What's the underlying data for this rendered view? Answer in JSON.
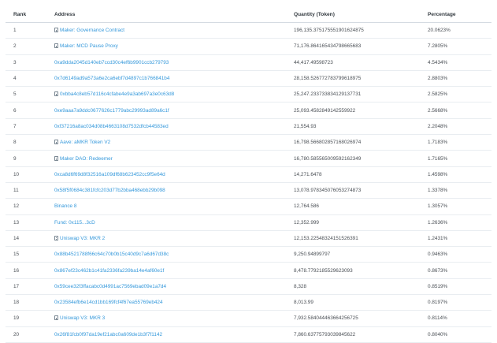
{
  "table": {
    "headers": {
      "rank": "Rank",
      "address": "Address",
      "quantity": "Quantity (Token)",
      "percentage": "Percentage"
    },
    "rows": [
      {
        "rank": "1",
        "address": "Maker: Governance Contract",
        "contract": true,
        "quantity": "196,135.375175551901624875",
        "percentage": "20.0623%"
      },
      {
        "rank": "2",
        "address": "Maker: MCD Pause Proxy",
        "contract": true,
        "quantity": "71,176.864165434798665683",
        "percentage": "7.2805%"
      },
      {
        "rank": "3",
        "address": "0xa9dda2045d140eb7ccd30c4ef6b9901ccb279793",
        "contract": false,
        "quantity": "44,417.49598723",
        "percentage": "4.5434%"
      },
      {
        "rank": "4",
        "address": "0x7d6149ad9a573a6e2ca6ebf7d4897c1b766841b4",
        "contract": false,
        "quantity": "28,158.526772783799618975",
        "percentage": "2.8803%"
      },
      {
        "rank": "5",
        "address": "0xbba4c8eb57d116c4cfabe4e9a3ab697a3e0c63d8",
        "contract": true,
        "quantity": "25,247.23373383412913773​1",
        "percentage": "2.5825%"
      },
      {
        "rank": "6",
        "address": "0xe9aaa7a9ddc0677626c1779abc29993ad89a6c1f",
        "contract": false,
        "quantity": "25,093.4582849142559922",
        "percentage": "2.5668%"
      },
      {
        "rank": "7",
        "address": "0xf37216a8ac034d08b4663108d7532dfcb44583ed",
        "contract": false,
        "quantity": "21,554.93",
        "percentage": "2.2048%"
      },
      {
        "rank": "8",
        "address": "Aave: aMKR Token V2",
        "contract": true,
        "quantity": "16,798.566802857168026974",
        "percentage": "1.7183%"
      },
      {
        "rank": "9",
        "address": "Maker DAO: Redeemer",
        "contract": true,
        "quantity": "16,780.585565009592162349",
        "percentage": "1.7165%"
      },
      {
        "rank": "10",
        "address": "0xca8d6f69d8f32516a109df68b623452cc9f5e64d",
        "contract": false,
        "quantity": "14,271.6478",
        "percentage": "1.4598%"
      },
      {
        "rank": "11",
        "address": "0x58f5f0684c381fcfc203d77b2bba468ebb29b098",
        "contract": false,
        "quantity": "13,078.978345076053274873",
        "percentage": "1.3378%"
      },
      {
        "rank": "12",
        "address": "Binance 8",
        "contract": false,
        "quantity": "12,764.586",
        "percentage": "1.3057%"
      },
      {
        "rank": "13",
        "address": "Fund: 0x115...3cD",
        "contract": false,
        "quantity": "12,352.999",
        "percentage": "1.2636%"
      },
      {
        "rank": "14",
        "address": "Uniswap V3: MKR 2",
        "contract": true,
        "quantity": "12,153.22548324151526391",
        "percentage": "1.2431%"
      },
      {
        "rank": "15",
        "address": "0x88b4521788f66c64c70b0b15c40d9c7a6d67d38c",
        "contract": false,
        "quantity": "9,250.94899797",
        "percentage": "0.9463%"
      },
      {
        "rank": "16",
        "address": "0x867ef23c462b1c41fa2336fa239ba14e4af60e1f",
        "contract": false,
        "quantity": "8,478.7792185529623093",
        "percentage": "0.8673%"
      },
      {
        "rank": "17",
        "address": "0x59cee32f3ffacabc0d4991ac7569ebad09e1a7d4",
        "contract": false,
        "quantity": "8,328",
        "percentage": "0.8519%"
      },
      {
        "rank": "18",
        "address": "0x23584efb6e14cd1bb169fcf4f67ea55769eb424",
        "contract": false,
        "quantity": "8,013.99",
        "percentage": "0.8197%"
      },
      {
        "rank": "19",
        "address": "Uniswap V3: MKR 3",
        "contract": true,
        "quantity": "7,932.584044463664256725",
        "percentage": "0.8114%"
      },
      {
        "rank": "20",
        "address": "0x26f81fcb0f97da19ef21abc0a609de1b3f7f1142",
        "contract": false,
        "quantity": "7,860.637757930398456​22",
        "percentage": "0.8040%"
      }
    ]
  }
}
